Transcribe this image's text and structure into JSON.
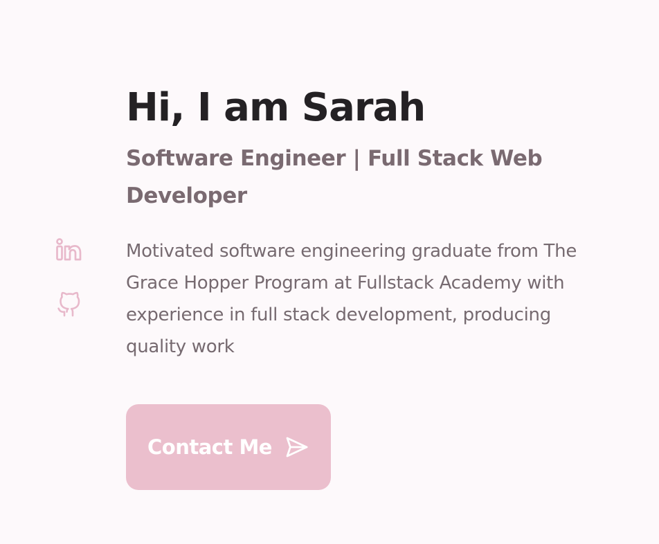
{
  "hero": {
    "title": "Hi, I am Sarah",
    "subtitle": "Software Engineer | Full Stack Web Developer",
    "description": "Motivated software engineering graduate from The Grace Hopper Program at Fullstack Academy with experience in full stack development, producing quality work"
  },
  "social": {
    "icons": [
      "linkedin-icon",
      "github-icon"
    ]
  },
  "contact": {
    "label": "Contact Me",
    "icon": "send-icon"
  },
  "colors": {
    "background": "#fdf9fb",
    "heading": "#242124",
    "text": "#766a70",
    "accent": "#ebbfcd",
    "icon": "#e8b9cb"
  }
}
